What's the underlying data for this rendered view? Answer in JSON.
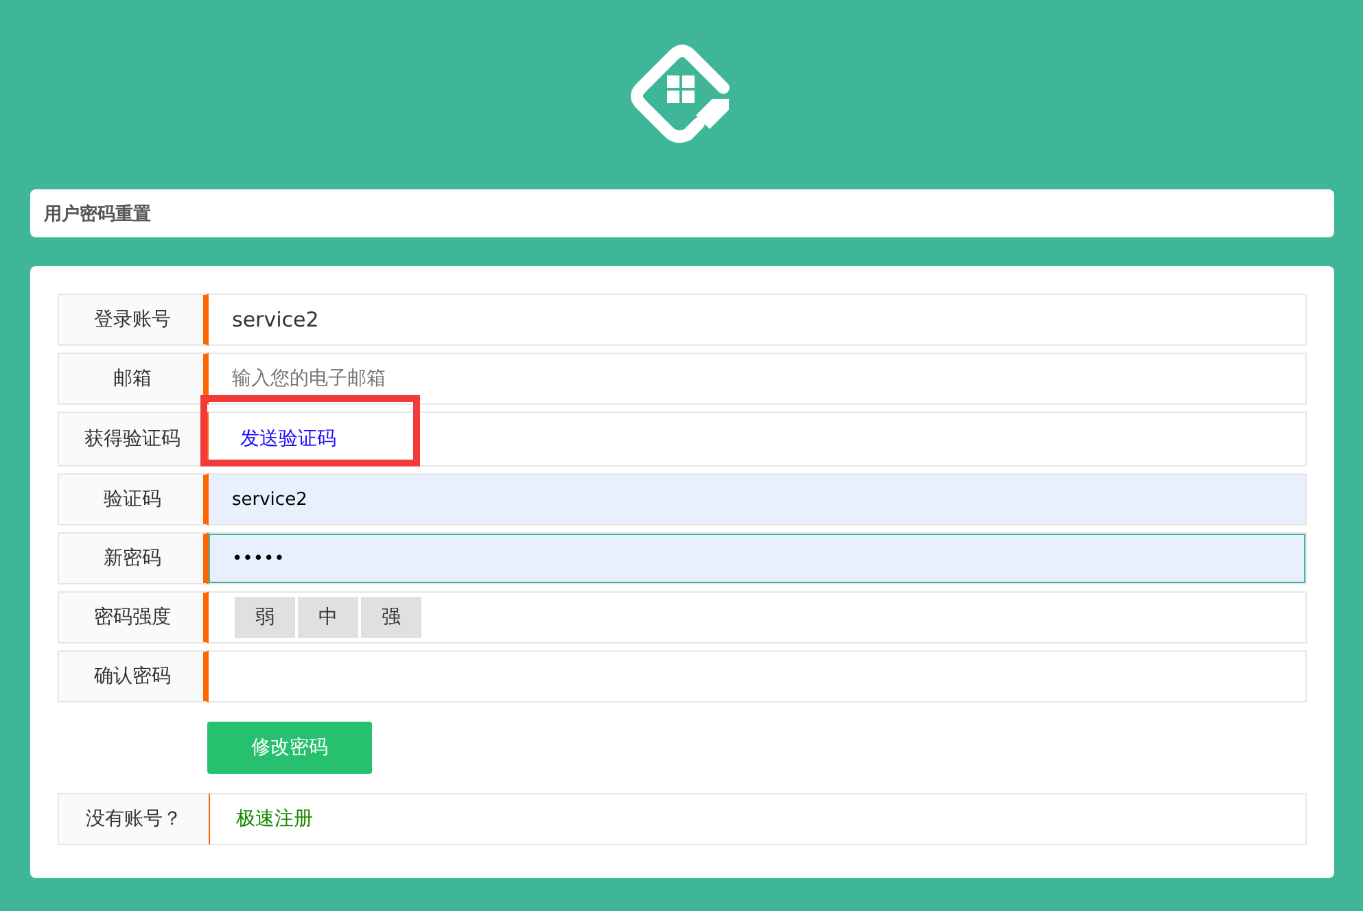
{
  "title": "用户密码重置",
  "fields": [
    {
      "kind": "text",
      "label": "登录账号",
      "value": "service2",
      "autofilled": false,
      "focused": false
    },
    {
      "kind": "placeholder",
      "label": "邮箱",
      "placeholder": "输入您的电子邮箱"
    },
    {
      "kind": "link",
      "label": "获得验证码",
      "link": "发送验证码",
      "highlighted": true
    },
    {
      "kind": "text",
      "label": "验证码",
      "value": "service2",
      "autofilled": true,
      "focused": false
    },
    {
      "kind": "text",
      "label": "新密码",
      "value": "•••••",
      "autofilled": true,
      "focused": true
    },
    {
      "kind": "strength",
      "label": "密码强度",
      "levels": [
        "弱",
        "中",
        "强"
      ]
    },
    {
      "kind": "text",
      "label": "确认密码",
      "autofilled": false,
      "focused": false
    }
  ],
  "submit": "修改密码",
  "register": {
    "label": "没有账号？",
    "link": "极速注册"
  }
}
